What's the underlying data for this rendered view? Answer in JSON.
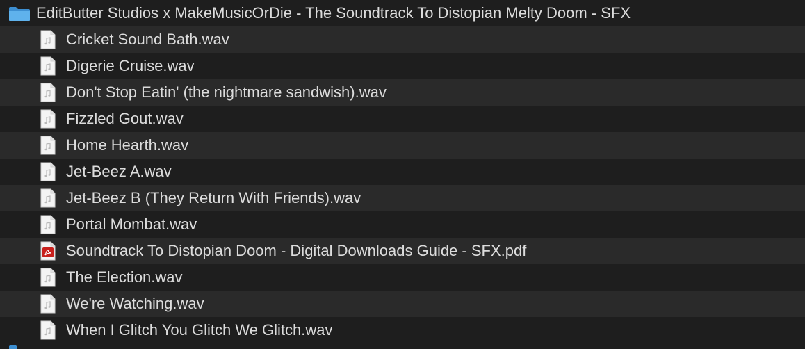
{
  "folder": {
    "name": "EditButter Studios x MakeMusicOrDie - The Soundtrack To Distopian Melty Doom - SFX",
    "icon": "folder-icon",
    "icon_color": "#4aa3e0"
  },
  "files": [
    {
      "name": "Cricket Sound Bath.wav",
      "icon": "audio-file-icon"
    },
    {
      "name": "Digerie Cruise.wav",
      "icon": "audio-file-icon"
    },
    {
      "name": "Don't Stop Eatin' (the nightmare sandwish).wav",
      "icon": "audio-file-icon"
    },
    {
      "name": "Fizzled Gout.wav",
      "icon": "audio-file-icon"
    },
    {
      "name": "Home Hearth.wav",
      "icon": "audio-file-icon"
    },
    {
      "name": "Jet-Beez A.wav",
      "icon": "audio-file-icon"
    },
    {
      "name": "Jet-Beez B (They Return With Friends).wav",
      "icon": "audio-file-icon"
    },
    {
      "name": "Portal Mombat.wav",
      "icon": "audio-file-icon"
    },
    {
      "name": "Soundtrack To Distopian Doom - Digital Downloads Guide - SFX.pdf",
      "icon": "pdf-file-icon"
    },
    {
      "name": "The Election.wav",
      "icon": "audio-file-icon"
    },
    {
      "name": "We're Watching.wav",
      "icon": "audio-file-icon"
    },
    {
      "name": "When I Glitch You Glitch We Glitch.wav",
      "icon": "audio-file-icon"
    }
  ],
  "colors": {
    "background": "#1e1e1e",
    "stripe": "#2a2a2a",
    "text": "#dcdcdc",
    "pdf_red": "#c8201c"
  }
}
